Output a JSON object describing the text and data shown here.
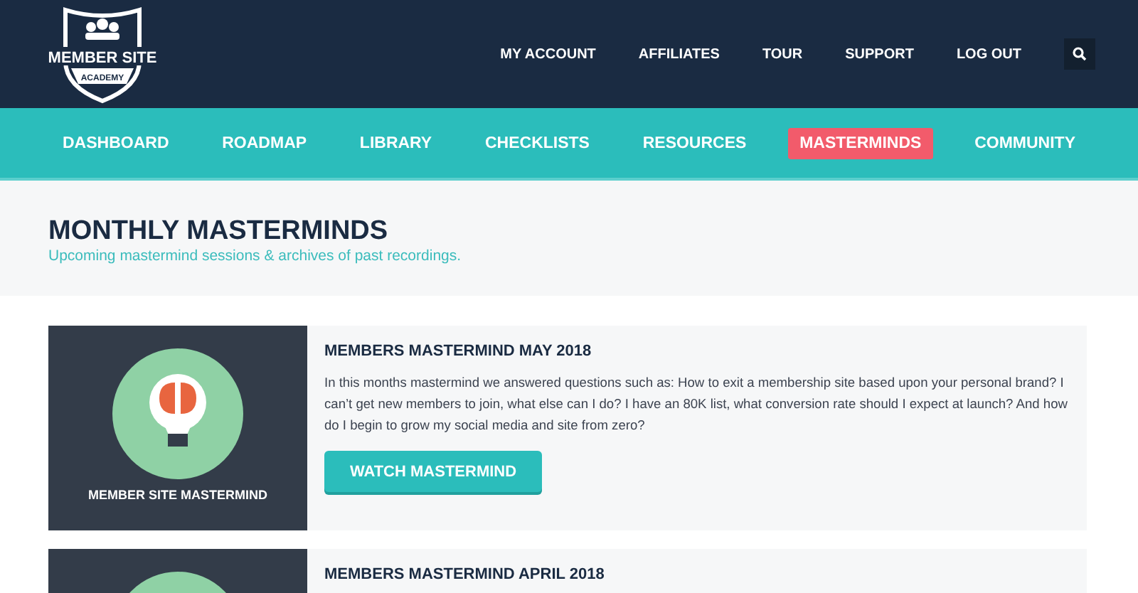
{
  "logo": {
    "line_1": "MEMBER SITE",
    "line_2": "ACADEMY"
  },
  "top_links": [
    {
      "label": "MY ACCOUNT"
    },
    {
      "label": "AFFILIATES"
    },
    {
      "label": "TOUR"
    },
    {
      "label": "SUPPORT"
    },
    {
      "label": "LOG OUT"
    }
  ],
  "nav": [
    {
      "label": "DASHBOARD",
      "selected": false
    },
    {
      "label": "ROADMAP",
      "selected": false
    },
    {
      "label": "LIBRARY",
      "selected": false
    },
    {
      "label": "CHECKLISTS",
      "selected": false
    },
    {
      "label": "RESOURCES",
      "selected": false
    },
    {
      "label": "MASTERMINDS",
      "selected": true
    },
    {
      "label": "COMMUNITY",
      "selected": false
    }
  ],
  "page_header": {
    "title": "MONTHLY MASTERMINDS",
    "subtitle": "Upcoming mastermind sessions & archives of past recordings."
  },
  "sessions": [
    {
      "thumbnail_caption": "MEMBER SITE MASTERMIND",
      "title": "MEMBERS MASTERMIND MAY 2018",
      "description": "In this months mastermind we answered questions such as: How to exit a membership site based upon your personal brand? I can’t get new members to join, what else can I do? I have an 80K list, what conversion rate should I expect at launch? And how do I begin to grow my social media and site from zero?",
      "button": "WATCH MASTERMIND"
    },
    {
      "title": "MEMBERS MASTERMIND APRIL 2018"
    }
  ]
}
